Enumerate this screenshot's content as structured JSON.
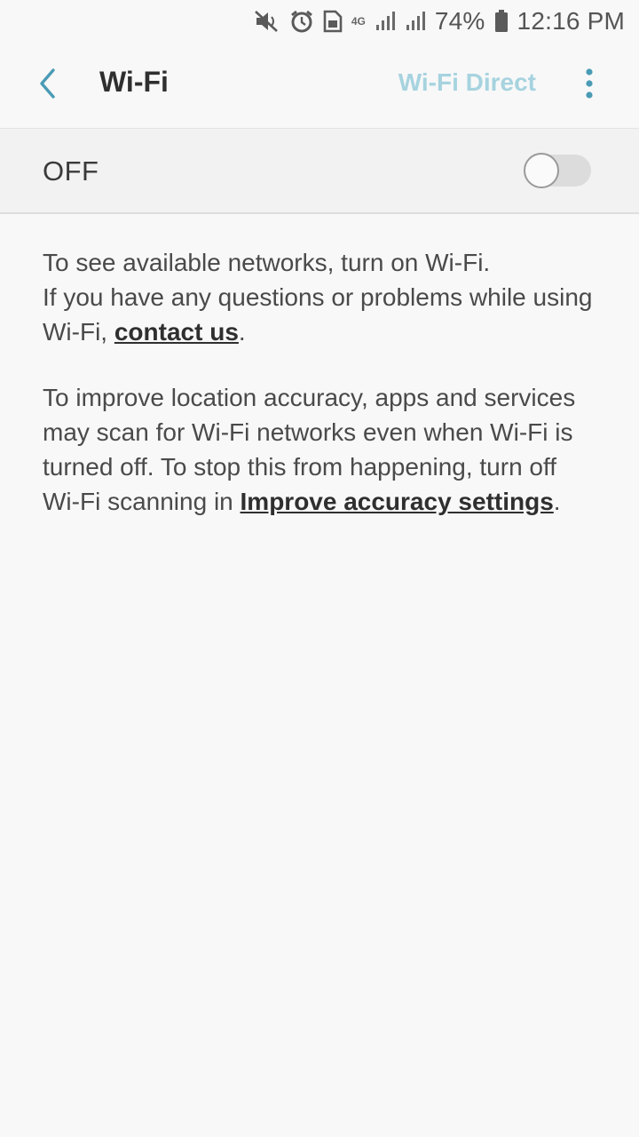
{
  "status_bar": {
    "network": "4G",
    "battery": "74%",
    "time": "12:16 PM",
    "icons": [
      "mute-icon",
      "alarm-icon",
      "sim-icon",
      "signal-icon",
      "signal-icon",
      "battery-icon"
    ]
  },
  "app_bar": {
    "title": "Wi-Fi",
    "action_label": "Wi-Fi Direct",
    "back_icon": "chevron-left-icon",
    "more_icon": "more-vertical-icon"
  },
  "toggle": {
    "label": "OFF",
    "state": "off"
  },
  "info": {
    "line1": "To see available networks, turn on Wi-Fi.",
    "line2_prefix": "If you have any questions or problems while using Wi-Fi, ",
    "contact_link": "contact us",
    "period": ".",
    "scan_prefix": "To improve location accuracy, apps and services may scan for Wi-Fi networks even when Wi-Fi is turned off. To stop this from happening, turn off Wi-Fi scanning in ",
    "scan_link": "Improve accuracy settings"
  },
  "colors": {
    "accent": "#4a9bb5",
    "action_disabled": "#a6d3df",
    "background": "#f8f8f8"
  }
}
